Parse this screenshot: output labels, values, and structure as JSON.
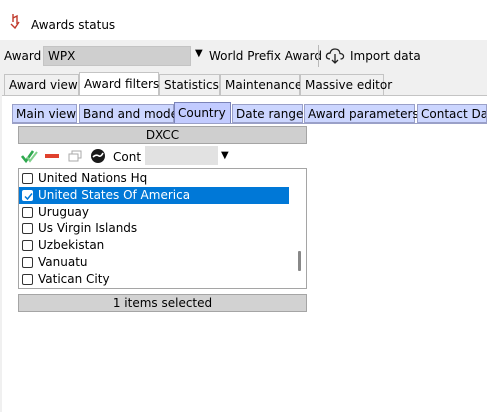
{
  "window": {
    "title": "Awards status",
    "icon": "award-status-icon"
  },
  "award_bar": {
    "label": "Award",
    "selected_award": "WPX",
    "award_name": "World Prefix Award",
    "import_label": "Import data",
    "import_icon": "cloud-download-icon"
  },
  "main_tabs": [
    {
      "label": "Award view",
      "active": false
    },
    {
      "label": "Award filters",
      "active": true
    },
    {
      "label": "Statistics",
      "active": false
    },
    {
      "label": "Maintenance",
      "active": false
    },
    {
      "label": "Massive editor",
      "active": false
    }
  ],
  "sub_tabs": [
    {
      "label": "Main view",
      "active": false
    },
    {
      "label": "Band and mode",
      "active": false
    },
    {
      "label": "Country",
      "active": true
    },
    {
      "label": "Date range",
      "active": false
    },
    {
      "label": "Award parameters",
      "active": false
    },
    {
      "label": "Contact Dat",
      "active": false
    }
  ],
  "dxcc": {
    "header": "DXCC",
    "cont_label": "Cont",
    "cont_value": "",
    "items": [
      {
        "label": "United Nations Hq",
        "checked": false,
        "selected": false
      },
      {
        "label": "United States Of America",
        "checked": true,
        "selected": true
      },
      {
        "label": "Uruguay",
        "checked": false,
        "selected": false
      },
      {
        "label": "Us Virgin Islands",
        "checked": false,
        "selected": false
      },
      {
        "label": "Uzbekistan",
        "checked": false,
        "selected": false
      },
      {
        "label": "Vanuatu",
        "checked": false,
        "selected": false
      },
      {
        "label": "Vatican City",
        "checked": false,
        "selected": false
      }
    ],
    "status": "1 items selected"
  },
  "colors": {
    "selection": "#0078d7",
    "sub_tab_bg": "#ccd6ff",
    "check_green": "#2fa84f",
    "uncheck_red": "#e0412d"
  }
}
